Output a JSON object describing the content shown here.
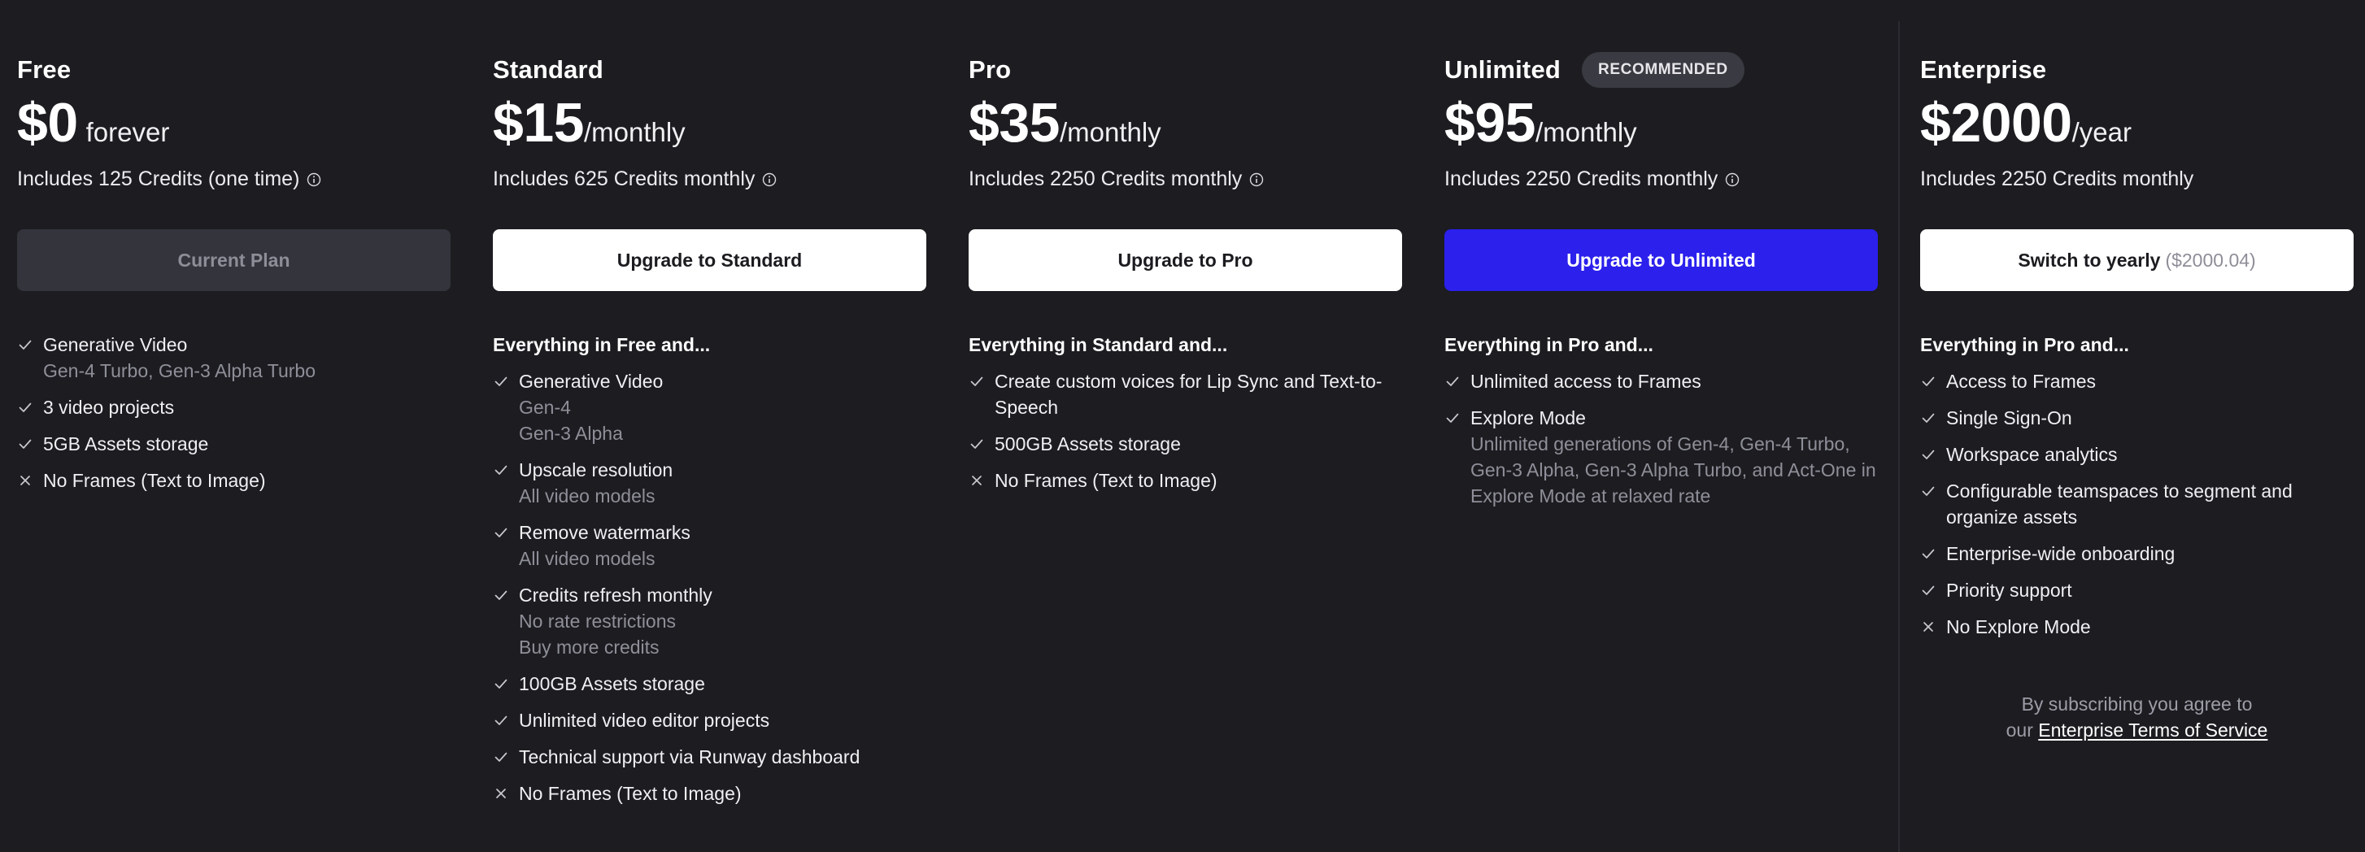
{
  "colors": {
    "background": "#1c1c21",
    "accent_blue": "#2b20ec",
    "muted_text": "#8f8f99",
    "current_plan_button": "#34343c"
  },
  "plans": [
    {
      "name": "Free",
      "price": "$0",
      "period": "forever",
      "credits": "Includes 125 Credits (one time)",
      "credits_info_icon": "info-circle-icon",
      "button": {
        "label": "Current Plan",
        "style": "current"
      },
      "features": [
        {
          "icon": "check-icon",
          "title": "Generative Video",
          "subs": [
            "Gen-4 Turbo, Gen-3 Alpha Turbo"
          ]
        },
        {
          "icon": "check-icon",
          "title": "3 video projects"
        },
        {
          "icon": "check-icon",
          "title": "5GB Assets storage"
        },
        {
          "icon": "x-icon",
          "title": "No Frames (Text to Image)"
        }
      ]
    },
    {
      "name": "Standard",
      "price": "$15",
      "period": "/monthly",
      "credits": "Includes 625 Credits monthly",
      "credits_info_icon": "info-circle-icon",
      "button": {
        "label": "Upgrade to Standard",
        "style": "white"
      },
      "features_intro": "Everything in Free and...",
      "features": [
        {
          "icon": "check-icon",
          "title": "Generative Video",
          "subs": [
            "Gen-4",
            "Gen-3 Alpha"
          ]
        },
        {
          "icon": "check-icon",
          "title": "Upscale resolution",
          "subs": [
            "All video models"
          ]
        },
        {
          "icon": "check-icon",
          "title": "Remove watermarks",
          "subs": [
            "All video models"
          ]
        },
        {
          "icon": "check-icon",
          "title": "Credits refresh monthly",
          "subs": [
            "No rate restrictions",
            "Buy more credits"
          ]
        },
        {
          "icon": "check-icon",
          "title": "100GB Assets storage"
        },
        {
          "icon": "check-icon",
          "title": "Unlimited video editor projects"
        },
        {
          "icon": "check-icon",
          "title": "Technical support via Runway dashboard"
        },
        {
          "icon": "x-icon",
          "title": "No Frames (Text to Image)"
        }
      ]
    },
    {
      "name": "Pro",
      "price": "$35",
      "period": "/monthly",
      "credits": "Includes 2250 Credits monthly",
      "credits_info_icon": "info-circle-icon",
      "button": {
        "label": "Upgrade to Pro",
        "style": "white"
      },
      "features_intro": "Everything in Standard and...",
      "features": [
        {
          "icon": "check-icon",
          "title": "Create custom voices for Lip Sync and Text-to-Speech"
        },
        {
          "icon": "check-icon",
          "title": "500GB Assets storage"
        },
        {
          "icon": "x-icon",
          "title": "No Frames (Text to Image)"
        }
      ]
    },
    {
      "name": "Unlimited",
      "badge": "RECOMMENDED",
      "price": "$95",
      "period": "/monthly",
      "credits": "Includes 2250 Credits monthly",
      "credits_info_icon": "info-circle-icon",
      "button": {
        "label": "Upgrade to Unlimited",
        "style": "blue"
      },
      "features_intro": "Everything in Pro and...",
      "features": [
        {
          "icon": "check-icon",
          "title": "Unlimited access to Frames"
        },
        {
          "icon": "check-icon",
          "title": "Explore Mode",
          "subs": [
            "Unlimited generations of Gen-4, Gen-4 Turbo, Gen-3 Alpha, Gen-3 Alpha Turbo, and Act-One in Explore Mode at relaxed rate"
          ]
        }
      ]
    },
    {
      "name": "Enterprise",
      "price": "$2000",
      "period": "/year",
      "credits": "Includes 2250 Credits monthly",
      "button": {
        "label": "Switch to yearly",
        "muted": "($2000.04)",
        "style": "white"
      },
      "features_intro": "Everything in Pro and...",
      "features": [
        {
          "icon": "check-icon",
          "title": "Access to Frames"
        },
        {
          "icon": "check-icon",
          "title": "Single Sign-On"
        },
        {
          "icon": "check-icon",
          "title": "Workspace analytics"
        },
        {
          "icon": "check-icon",
          "title": "Configurable teamspaces to segment and organize assets"
        },
        {
          "icon": "check-icon",
          "title": "Enterprise-wide onboarding"
        },
        {
          "icon": "check-icon",
          "title": "Priority support"
        },
        {
          "icon": "x-icon",
          "title": "No Explore Mode"
        }
      ],
      "terms": {
        "line1": "By subscribing you agree to",
        "prefix": "our",
        "link": "Enterprise Terms of Service"
      }
    }
  ]
}
